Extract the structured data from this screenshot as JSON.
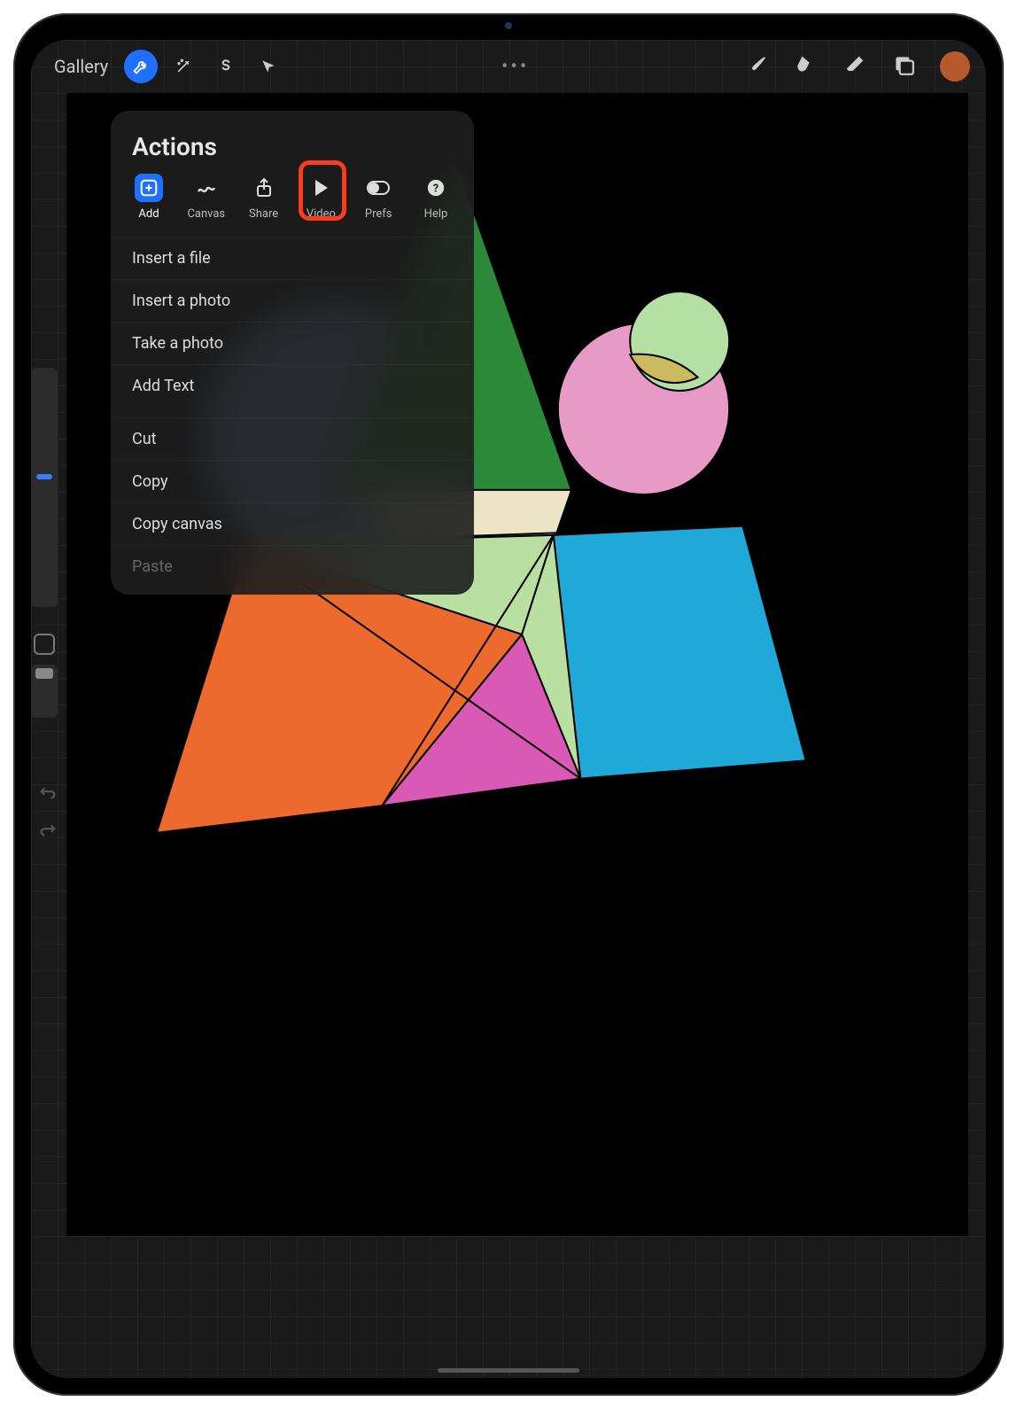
{
  "toolbar": {
    "gallery": "Gallery"
  },
  "popover": {
    "title": "Actions",
    "tabs": [
      {
        "label": "Add"
      },
      {
        "label": "Canvas"
      },
      {
        "label": "Share"
      },
      {
        "label": "Video"
      },
      {
        "label": "Prefs"
      },
      {
        "label": "Help"
      }
    ],
    "items": [
      {
        "label": "Insert a file"
      },
      {
        "label": "Insert a photo"
      },
      {
        "label": "Take a photo"
      },
      {
        "label": "Add Text"
      },
      {
        "label": "Cut"
      },
      {
        "label": "Copy"
      },
      {
        "label": "Copy canvas"
      },
      {
        "label": "Paste"
      }
    ]
  },
  "colors": {
    "accent": "#1f70ff",
    "highlight": "#ff3b1f",
    "swatch": "#b65a2e"
  }
}
